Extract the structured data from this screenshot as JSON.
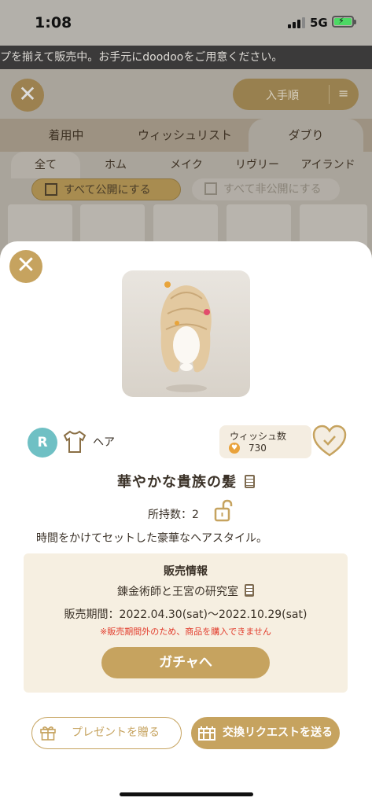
{
  "status_bar": {
    "time": "1:08",
    "network": "5G"
  },
  "marquee": {
    "text": "プを揃えて販売中。お手元にdoodooをご用意ください。"
  },
  "background": {
    "sort_label": "入手順",
    "tabs": [
      "着用中",
      "ウィッシュリスト",
      "ダブり"
    ],
    "active_tab": "ダブり",
    "subtabs": [
      "全て",
      "ホム",
      "メイク",
      "リヴリー",
      "アイランド"
    ],
    "publish_all": "すべて公開にする",
    "unpublish_all": "すべて非公開にする"
  },
  "item": {
    "rarity": "R",
    "category": "ヘア",
    "wish_label": "ウィッシュ数",
    "wish_count": "730",
    "name": "華やかな貴族の髪",
    "owned": "所持数：2",
    "description": "時間をかけてセットした豪華なヘアスタイル。"
  },
  "sale_info": {
    "heading": "販売情報",
    "shop": "錬金術師と王宮の研究室",
    "period": "販売期間：2022.04.30(sat)〜2022.10.29(sat)",
    "warning": "※販売期間外のため、商品を購入できません",
    "gacha_button": "ガチャへ"
  },
  "actions": {
    "present": "プレゼントを贈る",
    "trade": "交換リクエストを送る"
  },
  "colors": {
    "accent": "#c6a35f",
    "rarity_badge": "#6fc0c4",
    "warning": "#e23b2b"
  }
}
